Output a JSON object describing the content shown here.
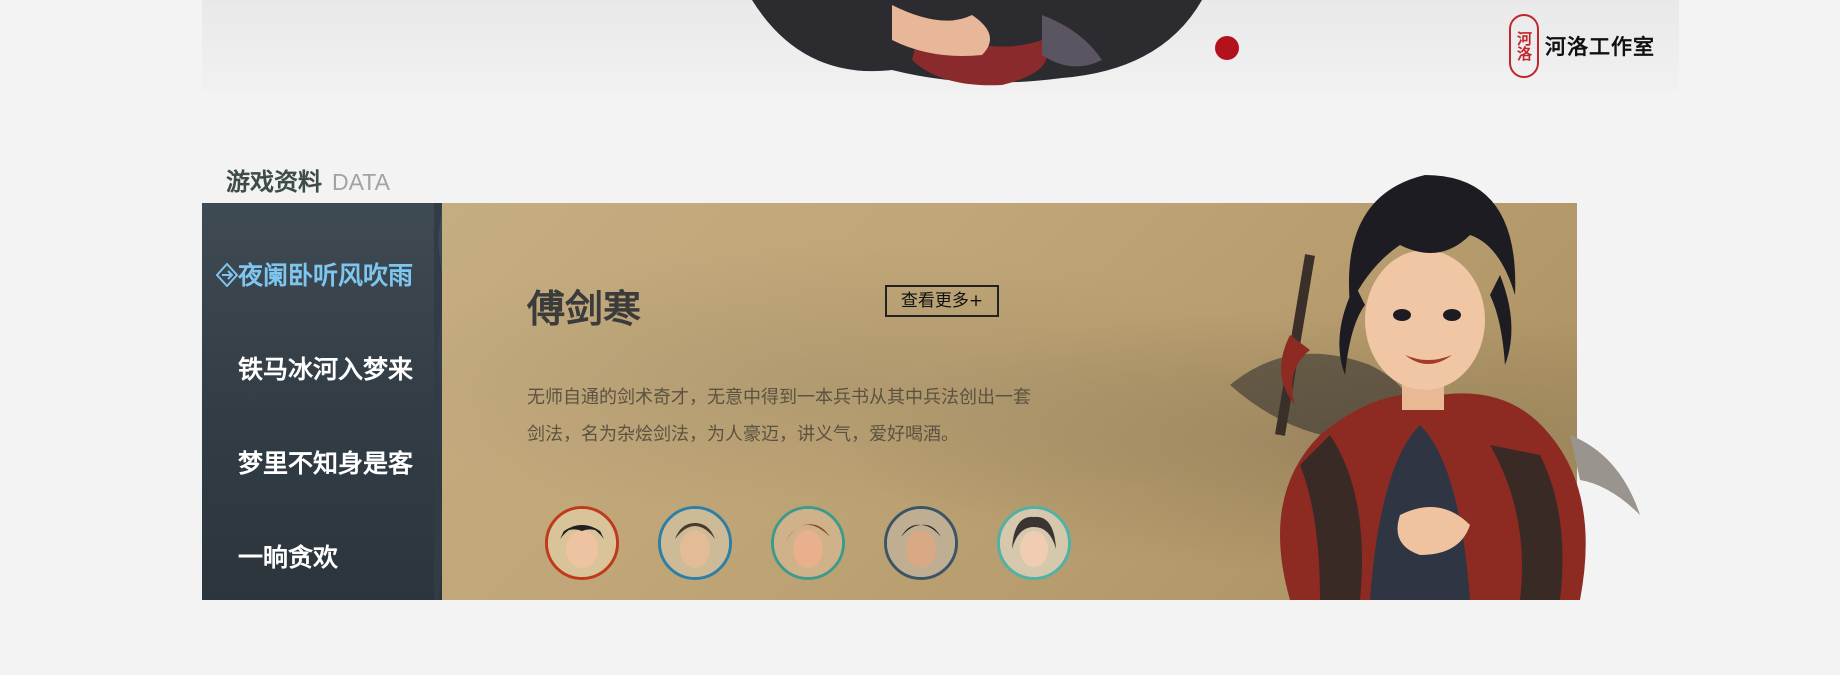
{
  "banner": {
    "studio_seal": "河洛",
    "studio_name": "河洛工作室",
    "colors": {
      "dot": "#b3121c",
      "seal": "#c0272d"
    }
  },
  "section": {
    "title_cn": "游戏资料",
    "title_en": "DATA"
  },
  "menu": {
    "items": [
      {
        "label": "夜阑卧听风吹雨",
        "active": true
      },
      {
        "label": "铁马冰河入梦来",
        "active": false
      },
      {
        "label": "梦里不知身是客",
        "active": false
      },
      {
        "label": "一晌贪欢",
        "active": false
      }
    ],
    "active_icon": "diamond-arrow-icon"
  },
  "character": {
    "name": "傅剑寒",
    "more_label": "查看更多+",
    "description_line1": "无师自通的剑术奇才，无意中得到一本兵书从其中兵法创出一套",
    "description_line2": "剑法，名为杂烩剑法，为人豪迈，讲义气，爱好喝酒。"
  },
  "avatars": [
    {
      "name": "avatar-1",
      "ring": "#c0391b"
    },
    {
      "name": "avatar-2",
      "ring": "#2e7fa6"
    },
    {
      "name": "avatar-3",
      "ring": "#3f9a8c"
    },
    {
      "name": "avatar-4",
      "ring": "#3b5566"
    },
    {
      "name": "avatar-5",
      "ring": "#4fb2a6"
    }
  ]
}
